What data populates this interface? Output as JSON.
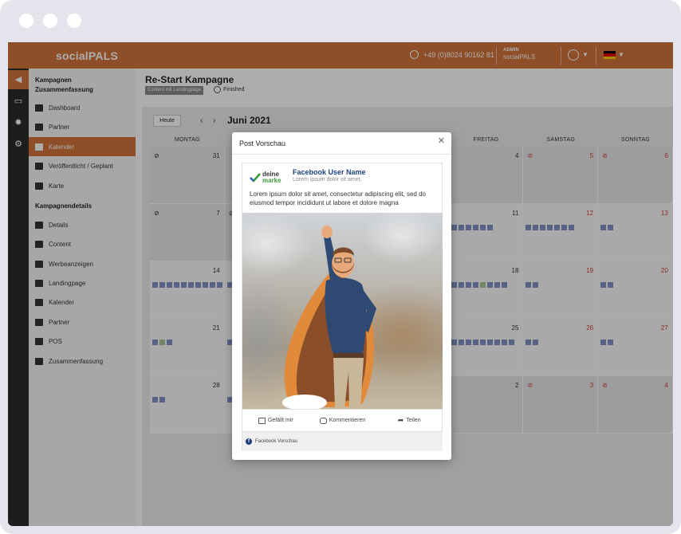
{
  "header": {
    "logo": "socialPALS",
    "phone": "+49 (0)8024 90162 81",
    "admin_role": "ADMIN",
    "admin_name": "socialPALS"
  },
  "iconbar": [
    "megaphone-icon",
    "calendar-icon",
    "lightbulb-icon",
    "gear-icon"
  ],
  "nav": {
    "section1_title": "Kampagnen Zusammenfassung",
    "section1_items": [
      {
        "label": "Dashboard",
        "icon": "dashboard-icon"
      },
      {
        "label": "Partner",
        "icon": "partner-icon"
      },
      {
        "label": "Kalender",
        "icon": "calendar-icon",
        "active": true
      },
      {
        "label": "Veröffentlicht / Geplant",
        "icon": "check-circle-icon"
      },
      {
        "label": "Karte",
        "icon": "map-pin-icon"
      }
    ],
    "section2_title": "Kampagnendetails",
    "section2_items": [
      {
        "label": "Details",
        "icon": "info-icon"
      },
      {
        "label": "Content",
        "icon": "content-icon"
      },
      {
        "label": "Werbeanzeigen",
        "icon": "ads-icon"
      },
      {
        "label": "Landingpage",
        "icon": "landingpage-icon"
      },
      {
        "label": "Kalender",
        "icon": "calendar-icon"
      },
      {
        "label": "Partner",
        "icon": "user-icon"
      },
      {
        "label": "POS",
        "icon": "cart-icon"
      },
      {
        "label": "Zusammenfassung",
        "icon": "clipboard-icon"
      }
    ]
  },
  "page": {
    "title": "Re-Start Kampagne",
    "tag": "Content mit Landingpage",
    "status": "Finished"
  },
  "calendar": {
    "today_label": "Heute",
    "month": "Juni 2021",
    "weekdays": [
      "MONTAG",
      "",
      "",
      "",
      "FREITAG",
      "SAMSTAG",
      "SONNTAG"
    ],
    "weeks": [
      [
        {
          "n": "31",
          "gray": true,
          "no": true
        },
        {
          "n": "",
          "gray": true
        },
        {
          "n": ""
        },
        {
          "n": ""
        },
        {
          "n": "4",
          "gray": true
        },
        {
          "n": "5",
          "red": true,
          "no": true,
          "gray": true
        },
        {
          "n": "6",
          "red": true,
          "no": true,
          "gray": true
        }
      ],
      [
        {
          "n": "7",
          "gray": true,
          "no": true
        },
        {
          "n": "",
          "gray": true,
          "no": true
        },
        {
          "n": ""
        },
        {
          "n": ""
        },
        {
          "n": "11",
          "sq": "bbbbbb"
        },
        {
          "n": "12",
          "red": true,
          "sq": "bbbbbbb"
        },
        {
          "n": "13",
          "red": true,
          "sq": "bb"
        }
      ],
      [
        {
          "n": "14",
          "sq": "bbbbbbbbbb"
        },
        {
          "n": "",
          "sq": "b"
        },
        {
          "n": ""
        },
        {
          "n": ""
        },
        {
          "n": "18",
          "sq": "bbbbgbbb"
        },
        {
          "n": "19",
          "red": true,
          "sq": "bb"
        },
        {
          "n": "20",
          "red": true,
          "sq": "bb"
        }
      ],
      [
        {
          "n": "21",
          "sq": "bgb"
        },
        {
          "n": "",
          "sq": "b"
        },
        {
          "n": ""
        },
        {
          "n": ""
        },
        {
          "n": "25",
          "sq": "bbbbbbbbb"
        },
        {
          "n": "26",
          "red": true,
          "sq": "bb"
        },
        {
          "n": "27",
          "red": true,
          "sq": "bb"
        }
      ],
      [
        {
          "n": "28",
          "sq": "bb"
        },
        {
          "n": "",
          "sq": "b"
        },
        {
          "n": ""
        },
        {
          "n": ""
        },
        {
          "n": "2",
          "gray": true
        },
        {
          "n": "3",
          "red": true,
          "no": true,
          "gray": true
        },
        {
          "n": "4",
          "red": true,
          "no": true,
          "gray": true
        }
      ]
    ]
  },
  "modal": {
    "title": "Post Vorschau",
    "brand_line1": "deine",
    "brand_line2": "marke",
    "username": "Facebook User Name",
    "subline": "Lorem ipsum dolor sit amet,",
    "text": "Lorem ipsum dolor sit amet, consectetur adipiscing elit, sed do eiusmod tempor incididunt ut labore et dolore magna",
    "like": "Gefällt mir",
    "comment": "Kommentieren",
    "share": "Teilen",
    "footer": "Facebook Vorschau"
  },
  "colors": {
    "accent": "#d2733a",
    "brand_blue": "#1d3f7a",
    "event": "#8093c0",
    "weekend": "#d23c3c"
  }
}
